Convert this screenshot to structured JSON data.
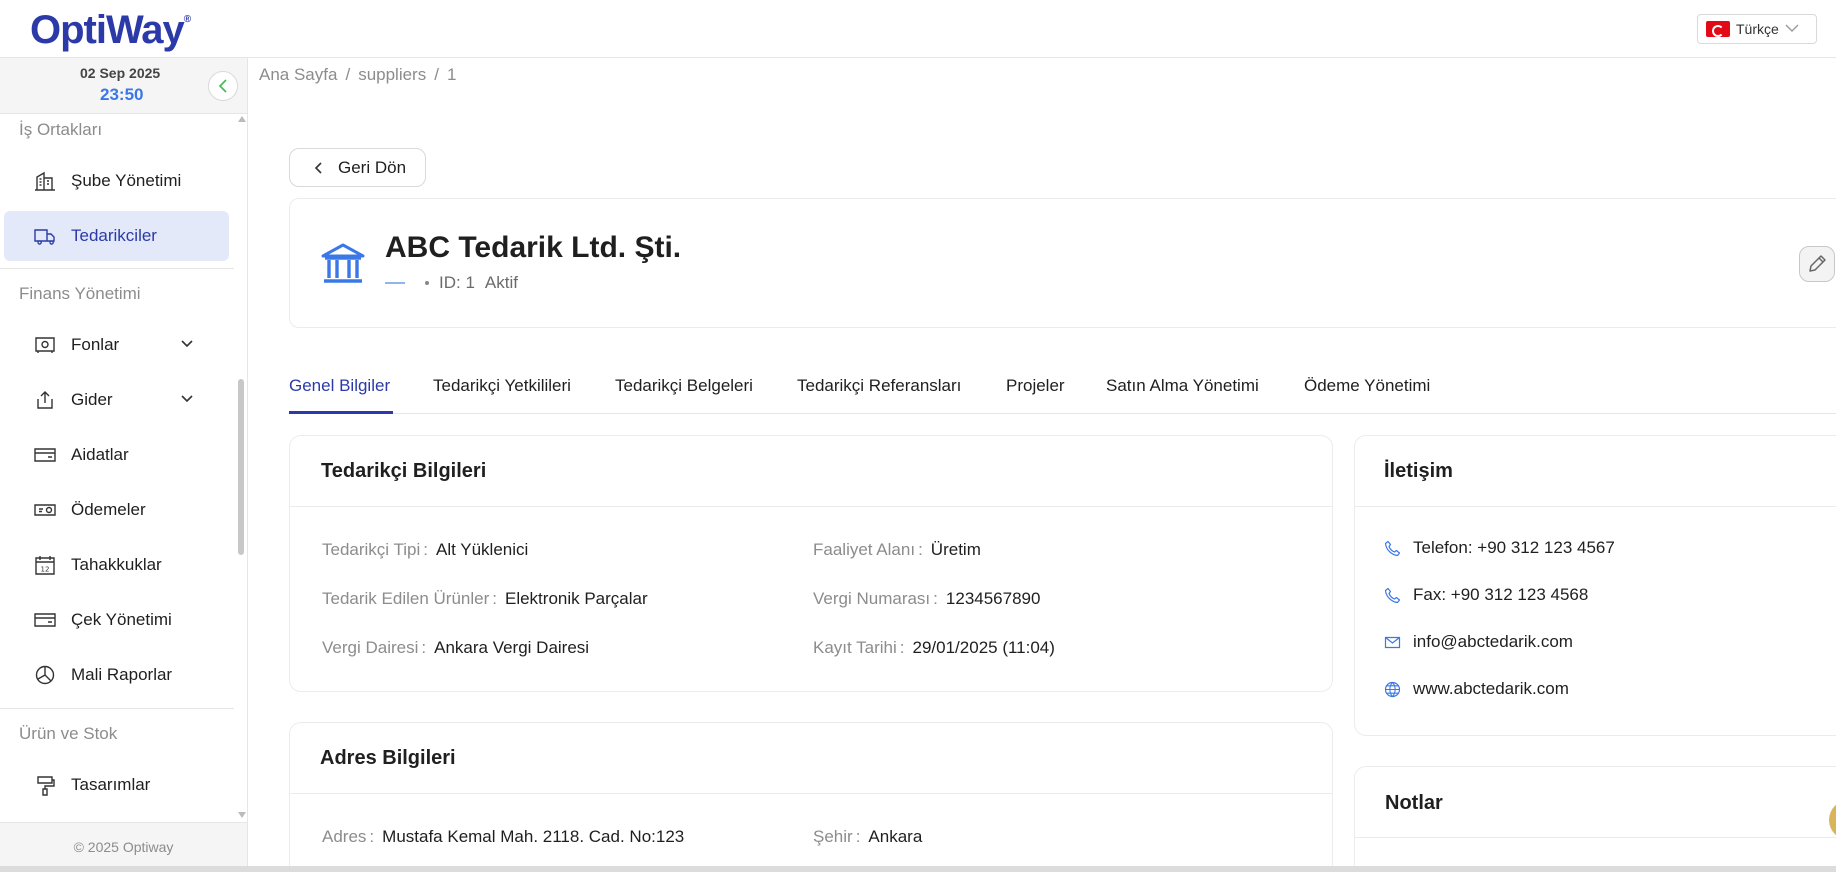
{
  "header": {
    "logo": "OptiWay",
    "logo_mark": "®",
    "language": "Türkçe",
    "colors": {
      "brand": "#2b3aa8",
      "accent": "#3b78e7"
    }
  },
  "sidebar": {
    "date": "02 Sep 2025",
    "time": "23:50",
    "sections": {
      "partners": "İş Ortakları",
      "finance": "Finans Yönetimi",
      "product": "Ürün ve Stok"
    },
    "items": {
      "branch": "Şube Yönetimi",
      "suppliers": "Tedarikciler",
      "funds": "Fonlar",
      "expense": "Gider",
      "dues": "Aidatlar",
      "payments": "Ödemeler",
      "accruals": "Tahakkuklar",
      "checks": "Çek Yönetimi",
      "reports": "Mali Raporlar",
      "designs": "Tasarımlar"
    },
    "footer": "© 2025 Optiway"
  },
  "breadcrumb": {
    "home": "Ana Sayfa",
    "sep": "/",
    "section": "suppliers",
    "id": "1"
  },
  "back_label": "Geri Dön",
  "supplier": {
    "name": "ABC Tedarik Ltd. Şti.",
    "id_text": "ID: 1",
    "status": "Aktif"
  },
  "tabs": [
    "Genel Bilgiler",
    "Tedarikçi Yetkilileri",
    "Tedarikçi Belgeleri",
    "Tedarikçi Referansları",
    "Projeler",
    "Satın Alma Yönetimi",
    "Ödeme Yönetimi"
  ],
  "info": {
    "title": "Tedarikçi Bilgileri",
    "colon": ":",
    "type_label": "Tedarikçi Tipi",
    "type_value": "Alt Yüklenici",
    "area_label": "Faaliyet Alanı",
    "area_value": "Üretim",
    "products_label": "Tedarik Edilen Ürünler",
    "products_value": "Elektronik Parçalar",
    "tax_no_label": "Vergi Numarası",
    "tax_no_value": "1234567890",
    "tax_office_label": "Vergi Dairesi",
    "tax_office_value": "Ankara Vergi Dairesi",
    "reg_date_label": "Kayıt Tarihi",
    "reg_date_value": "29/01/2025 (11:04)"
  },
  "contact": {
    "title": "İletişim",
    "phone": "Telefon: +90 312 123 4567",
    "fax": "Fax: +90 312 123 4568",
    "email": "info@abctedarik.com",
    "web": "www.abctedarik.com"
  },
  "address": {
    "title": "Adres Bilgileri",
    "address_label": "Adres",
    "address_value": "Mustafa Kemal Mah. 2118. Cad. No:123",
    "city_label": "Şehir",
    "city_value": "Ankara"
  },
  "notes": {
    "title": "Notlar"
  }
}
